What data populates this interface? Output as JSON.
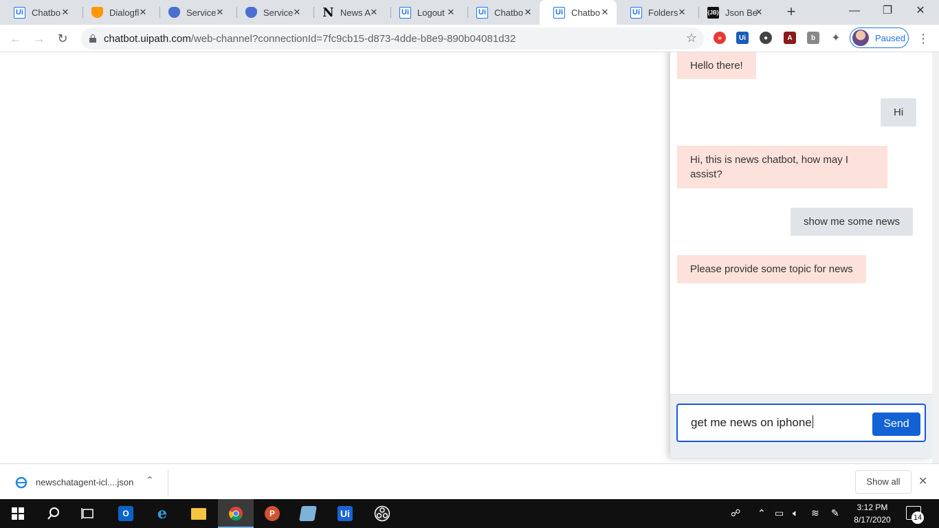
{
  "browser": {
    "tabs": [
      {
        "title": "Chatbo",
        "favicon": "uipath-icon",
        "active": false
      },
      {
        "title": "Dialogfl",
        "favicon": "dialogflow-icon",
        "active": false
      },
      {
        "title": "Service",
        "favicon": "shield-icon",
        "active": false
      },
      {
        "title": "Service",
        "favicon": "shield-icon",
        "active": false
      },
      {
        "title": "News A",
        "favicon": "notion-icon",
        "active": false
      },
      {
        "title": "Logout",
        "favicon": "uipath-icon",
        "active": false
      },
      {
        "title": "Chatbo",
        "favicon": "uipath-icon",
        "active": false
      },
      {
        "title": "Chatbo",
        "favicon": "uipath-icon",
        "active": true
      },
      {
        "title": "Folders",
        "favicon": "uipath-icon",
        "active": false
      },
      {
        "title": "Json Be",
        "favicon": "json-beautifier-icon",
        "active": false
      }
    ],
    "url_host": "chatbot.uipath.com",
    "url_rest": "/web-channel?connectionId=7fc9cb15-d873-4dde-b8e9-890b04081d32",
    "profile_label": "Paused",
    "accent_color": "#1a73e8"
  },
  "chat": {
    "messages": [
      {
        "sender": "bot",
        "text": "Hello there!"
      },
      {
        "sender": "user",
        "text": "Hi"
      },
      {
        "sender": "bot",
        "text": "Hi, this is news chatbot, how may I assist?"
      },
      {
        "sender": "user",
        "text": "show me some news"
      },
      {
        "sender": "bot",
        "text": "Please provide some topic for news"
      }
    ],
    "input_value": "get me news on iphone",
    "send_label": "Send",
    "bot_bubble_color": "#fde1db",
    "user_bubble_color": "#e0e4e8",
    "send_color": "#1262d5"
  },
  "downloads": {
    "file_name": "newschatagent-icl....json",
    "show_all_label": "Show all"
  },
  "taskbar": {
    "time": "3:12 PM",
    "date": "8/17/2020",
    "notification_count": "14"
  }
}
